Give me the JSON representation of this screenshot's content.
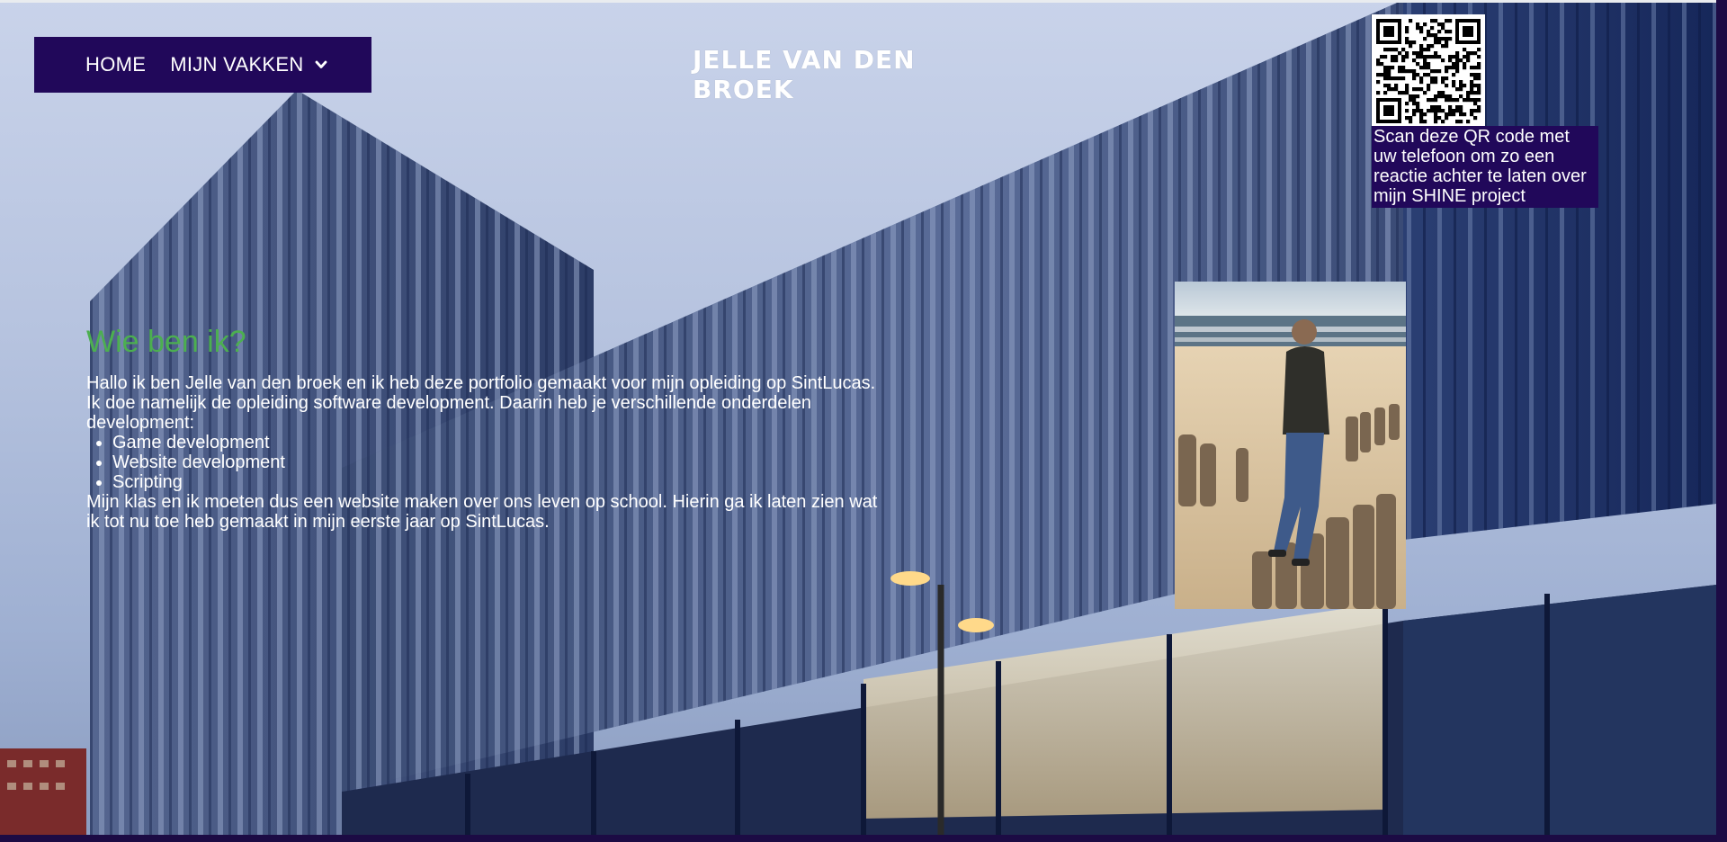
{
  "nav": {
    "home_label": "HOME",
    "vakken_label": "MIJN VAKKEN",
    "vakken_icon": "chevron-down-icon"
  },
  "site": {
    "title": "JELLE VAN DEN BROEK"
  },
  "qr": {
    "icon": "qr-code-icon",
    "caption": "Scan deze QR code met uw telefoon om zo een reactie achter te laten over mijn SHINE project"
  },
  "intro": {
    "heading": "Wie ben ik?",
    "paragraph1": "Hallo ik ben Jelle van den broek en ik heb deze portfolio gemaakt voor mijn opleiding op SintLucas. Ik doe namelijk de opleiding software development. Daarin heb je verschillende onderdelen development:",
    "items": [
      "Game development",
      "Website development",
      "Scripting"
    ],
    "paragraph2": "Mijn klas en ik moeten dus een website maken over ons leven op school. Hierin ga ik laten zien wat ik tot nu toe heb gemaakt in mijn eerste jaar op SintLucas."
  },
  "colors": {
    "nav_bg": "#21085a",
    "heading_green": "#4caf50",
    "text": "#ffffff"
  }
}
